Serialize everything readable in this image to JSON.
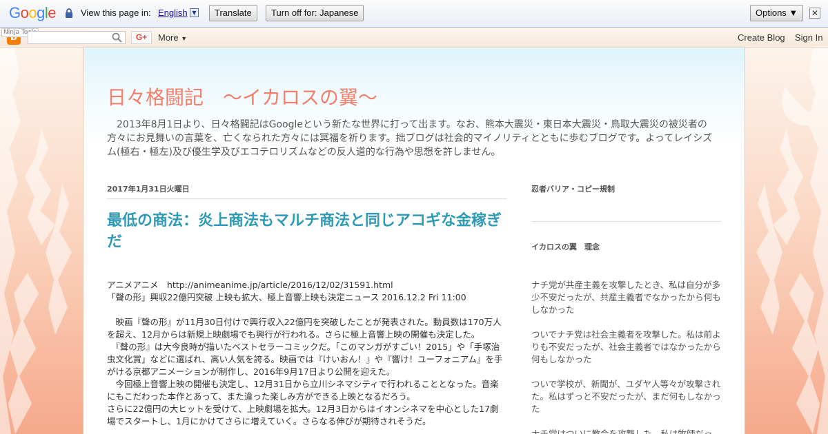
{
  "translate_bar": {
    "logo": "Google",
    "view_text": "View this page in:",
    "language": "English",
    "translate_button": "Translate",
    "turn_off_button": "Turn off for: Japanese",
    "options_button": "Options ▼",
    "close": "✕"
  },
  "navbar": {
    "ninja_tools": "Ninja Tools",
    "gplus": "G+",
    "more": "More",
    "create_blog": "Create Blog",
    "sign_in": "Sign In"
  },
  "header": {
    "title": "日々格闘記　～イカロスの翼～",
    "description": "　2013年8月1日より、日々格闘記はGoogleという新たな世界に打って出ます。なお、熊本大震災・東日本大震災・鳥取大震災の被災者の方々にお見舞いの言葉を、亡くなられた方々には冥福を祈ります。拙ブログは社会的マイノリティとともに歩むブログです。よってレイシズム(極右・極左)及び優生学及びエコテロリズムなどの反人道的な行為や思想を許しません。"
  },
  "post": {
    "date": "2017年1月31日火曜日",
    "title": "最低の商法：炎上商法もマルチ商法と同じアコギな金稼ぎだ",
    "source_line": "アニメアニメ　http://animeanime.jp/article/2016/12/02/31591.html",
    "source_title": "「聲の形」興収22億円突破 上映も拡大、極上音響上映も決定ニュース 2016.12.2 Fri 11:00",
    "paragraph_1": "　映画『聲の形』が11月30日付けで興行収入22億円を突破したことが発表された。動員数は170万人を超え、12月からは新規上映劇場でも興行が行われる。さらに極上音響上映の開催も決定した。",
    "paragraph_2": "　『聲の形』は大今良時が描いたベストセラーコミックだ。「このマンガがすごい！2015」や「手塚治虫文化賞」などに選ばれ、高い人気を誇る。映画では『けいおん！』や『響け！ユーフォニアム』を手がける京都アニメーションが制作し、2016年9月17日より公開を迎えた。",
    "paragraph_3": "　今回極上音響上映の開催も決定し、12月31日から立川シネマシティで行われることとなった。音楽にもこだわった本作とあって、また違った楽しみ方ができる上映となるだろう。",
    "paragraph_4": "さらに22億円の大ヒットを受けて、上映劇場を拡大。12月3日からはイオンシネマを中心とした17劇場でスタートし、1月にかけてさらに増えていく。さらなる伸びが期待されそうだ。"
  },
  "sidebar": {
    "widget_1_title": "忍者バリア・コピー規制",
    "widget_2_title": "イカロスの翼　理念",
    "creed_1": "ナチ党が共産主義を攻撃したとき、私は自分が多少不安だったが、共産主義者でなかったから何もしなかった",
    "creed_2": "ついでナチ党は社会主義者を攻撃した。私は前よりも不安だったが、社会主義者ではなかったから何もしなかった",
    "creed_3": "ついで学校が、新聞が、ユダヤ人等々が攻撃された。私はずっと不安だったが、まだ何もしなかった",
    "creed_4": "ナチ党はついに教会を攻撃した。私は牧師だっ"
  },
  "colors": {
    "title": "#f0806c",
    "post_title": "#2f9ab5",
    "background": "#fbe3d3"
  }
}
